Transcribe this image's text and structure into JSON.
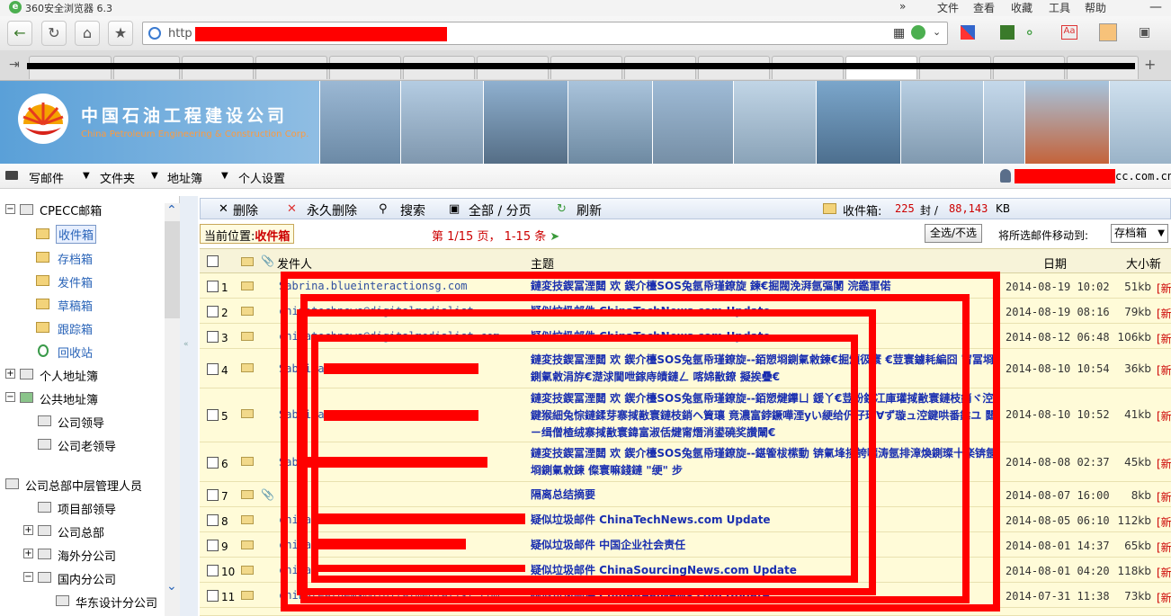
{
  "browser": {
    "title": "360安全浏览器 6.3",
    "menu": [
      "文件",
      "查看",
      "收藏",
      "工具",
      "帮助"
    ],
    "url_prefix": "http"
  },
  "banner": {
    "company_cn": "中国石油工程建设公司",
    "company_en": "China Petroleum Engineering & Construction Corp."
  },
  "mail_menu": {
    "write": "写邮件",
    "folders": "文件夹",
    "addressbook": "地址簿",
    "settings": "个人设置",
    "user_suffix": "cc.com.cn"
  },
  "sidebar": {
    "root": "CPECC邮箱",
    "folders": [
      "收件箱",
      "存档箱",
      "发件箱",
      "草稿箱",
      "跟踪箱",
      "回收站"
    ],
    "personal_book": "个人地址簿",
    "public_book": "公共地址簿",
    "public_items": [
      "公司领导",
      "公司老领导"
    ],
    "mid_managers": "公司总部中层管理人员",
    "mid_items": [
      "项目部领导",
      "公司总部",
      "海外分公司",
      "国内分公司",
      "华东设计分公司"
    ]
  },
  "toolbar": {
    "delete": "删除",
    "perm_delete": "永久删除",
    "search": "搜索",
    "all_pages": "全部 / 分页",
    "refresh": "刷新",
    "inbox_label": "收件箱:",
    "inbox_count": "225",
    "inbox_unit": "封 /",
    "inbox_size": "88,143",
    "inbox_size_unit": "KB"
  },
  "location": {
    "label": "当前位置:",
    "value": "收件箱"
  },
  "pager": {
    "text": "第 1/15 页， 1-15 条"
  },
  "actions": {
    "select_all": "全选/不选",
    "move_label": "将所选邮件移动到:",
    "move_target": "存档箱"
  },
  "table": {
    "headers": {
      "sender": "发件人",
      "subject": "主题",
      "date": "日期",
      "size": "大小",
      "new": "新邮"
    },
    "rows": [
      {
        "num": "1",
        "sender": "Sabrina.blueinteractionsg.com",
        "subject": "鏈変技鍥冨湮閮 欢 鍥介檯SOS兔氬帋瑾鐐旋  鍊€掘閥浼湃氬彄閺  浣鑑軍偌",
        "date": "2014-08-19 10:02",
        "size": "51kb",
        "new": "[新"
      },
      {
        "num": "2",
        "sender": "chinatechnews@digitalmedialist",
        "subject": "疑似垃圾邮件 ChinaTechNews.com Update",
        "date": "2014-08-19 08:16",
        "size": "79kb",
        "new": "[新"
      },
      {
        "num": "3",
        "sender": "chinatechnews@digitalmedialist.com",
        "subject": "疑似垃圾邮件 ChinaTechNews.com Update",
        "date": "2014-08-12 06:48",
        "size": "106kb",
        "new": "[新"
      },
      {
        "num": "4",
        "sender": "Sabrina",
        "subject": "鏈変技鍥冨湮閮  欢 鍥介檯SOS兔氬帋瑾鐐旋--銆愬埛鍘氭敹鍊€掘頒彶寰  €荳寰鐪耗編囧  甯冨埛鍘氭敹涓斿€濋浗閫呭鎵庤皟鏈ㄥ 喀婂敾鐐 擬挨疊€",
        "date": "2014-08-10 10:54",
        "size": "36kb",
        "new": "[新"
      },
      {
        "num": "5",
        "sender": "Sabrina",
        "subject": "鏈変技鍥冨湮閮  欢 鍥介檯SOS兔氬帋瑾鐐旋--銆愬煡鑻ㄩ  鍰丫€荳纷鎸冮庫瓘掝敾寰鏈枝銷ヾ涳鍵猴細兔悰鏈鍒芽寨掝敾寰鏈枝銷ヘ簤瓖  竟濃富鋍鐝嘩湮yい綆给伬仔瓘∀ず璇ュ涳鍵哄番鍏ユ  閮ㄧ缉僧楂绒寨掝敾寰鍏富淑佸煡甯熸消鍙磽奖讚閳€",
        "date": "2014-08-10 10:52",
        "size": "41kb",
        "new": "[新"
      },
      {
        "num": "6",
        "sender": "Sabrina",
        "subject": "鏈変技鍥冨湮閮  欢 鍥介檯SOS兔氬帋瑾鐐旋--鍖篧柭橴動  锛氭埄掞誇囖涛氬排漳煥鍘璨十楽锛氬埛鍘氭敹鍊  儏寰嘛錢鏈  \"绠\" 步",
        "date": "2014-08-08 02:37",
        "size": "45kb",
        "new": "[新"
      },
      {
        "num": "7",
        "sender": "",
        "subject": "隔离总结摘要",
        "date": "2014-08-07 16:00",
        "size": "8kb",
        "new": "[新"
      },
      {
        "num": "8",
        "sender": "chinat",
        "subject": "疑似垃圾邮件 ChinaTechNews.com Update",
        "date": "2014-08-05 06:10",
        "size": "112kb",
        "new": "[新"
      },
      {
        "num": "9",
        "sender": "chinac",
        "subject": "疑似垃圾邮件 中国企业社会责任",
        "date": "2014-08-01 14:37",
        "size": "65kb",
        "new": "[新"
      },
      {
        "num": "10",
        "sender": "chinas",
        "subject": "疑似垃圾邮件 ChinaSourcingNews.com Update",
        "date": "2014-08-01 04:20",
        "size": "118kb",
        "new": "[新"
      },
      {
        "num": "11",
        "sender": "chinarealnews@digitalmedialist.com",
        "subject": "疑似垃圾邮件 ChinaRealNews.com Update",
        "date": "2014-07-31 11:38",
        "size": "73kb",
        "new": "[新"
      }
    ]
  }
}
